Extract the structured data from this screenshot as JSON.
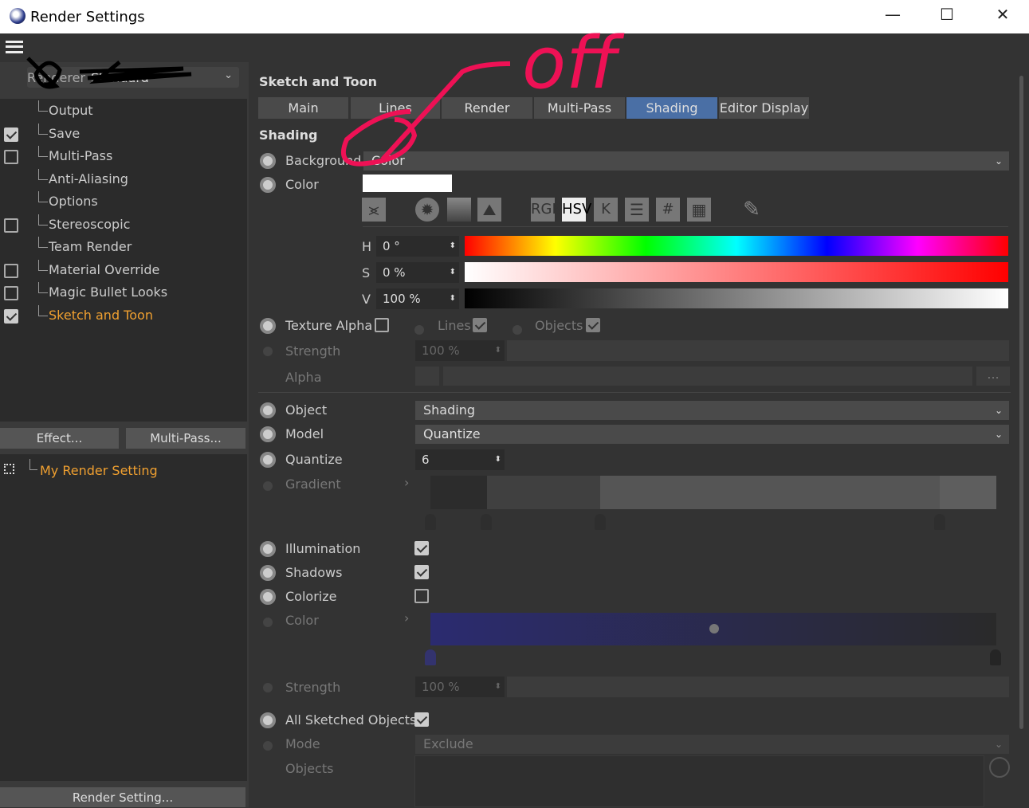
{
  "window": {
    "title": "Render Settings",
    "min": "—",
    "max": "☐",
    "close": "✕"
  },
  "renderer": {
    "label": "Renderer",
    "value": "Standard"
  },
  "tree": [
    {
      "label": "Output",
      "check": null
    },
    {
      "label": "Save",
      "check": true
    },
    {
      "label": "Multi-Pass",
      "check": false
    },
    {
      "label": "Anti-Aliasing",
      "check": null
    },
    {
      "label": "Options",
      "check": null
    },
    {
      "label": "Stereoscopic",
      "check": false
    },
    {
      "label": "Team Render",
      "check": null
    },
    {
      "label": "Material Override",
      "check": false
    },
    {
      "label": "Magic Bullet Looks",
      "check": false
    },
    {
      "label": "Sketch and Toon",
      "check": true,
      "active": true
    }
  ],
  "buttons": {
    "effect": "Effect...",
    "multipass": "Multi-Pass...",
    "render_setting": "Render Setting..."
  },
  "settings_list": {
    "item": "My Render Setting"
  },
  "panel": {
    "title": "Sketch and Toon",
    "section": "Shading"
  },
  "tabs": [
    "Main",
    "Lines",
    "Render",
    "Multi-Pass",
    "Shading",
    "Editor Display"
  ],
  "active_tab": "Shading",
  "shading": {
    "background_label": "Background",
    "background_value": "Color",
    "color_label": "Color",
    "color_value": "#ffffff",
    "color_modes": [
      "RGB",
      "HSV",
      "K",
      "#"
    ],
    "h_label": "H",
    "h_value": "0 °",
    "s_label": "S",
    "s_value": "0 %",
    "v_label": "V",
    "v_value": "100 %",
    "texture_alpha": "Texture Alpha",
    "lines": "Lines",
    "objects": "Objects",
    "strength": "Strength",
    "strength_value": "100 %",
    "alpha": "Alpha",
    "ellipsis": "...",
    "object_label": "Object",
    "object_value": "Shading",
    "model_label": "Model",
    "model_value": "Quantize",
    "quantize_label": "Quantize",
    "quantize_value": "6",
    "gradient_label": "Gradient",
    "illumination": "Illumination",
    "shadows": "Shadows",
    "colorize": "Colorize",
    "color2": "Color",
    "strength2": "Strength",
    "strength2_value": "100 %",
    "all_sketched": "All Sketched Objects",
    "mode_label": "Mode",
    "mode_value": "Exclude",
    "objects_label": "Objects"
  },
  "annotation": {
    "text": "off",
    "color": "#ee1155"
  }
}
